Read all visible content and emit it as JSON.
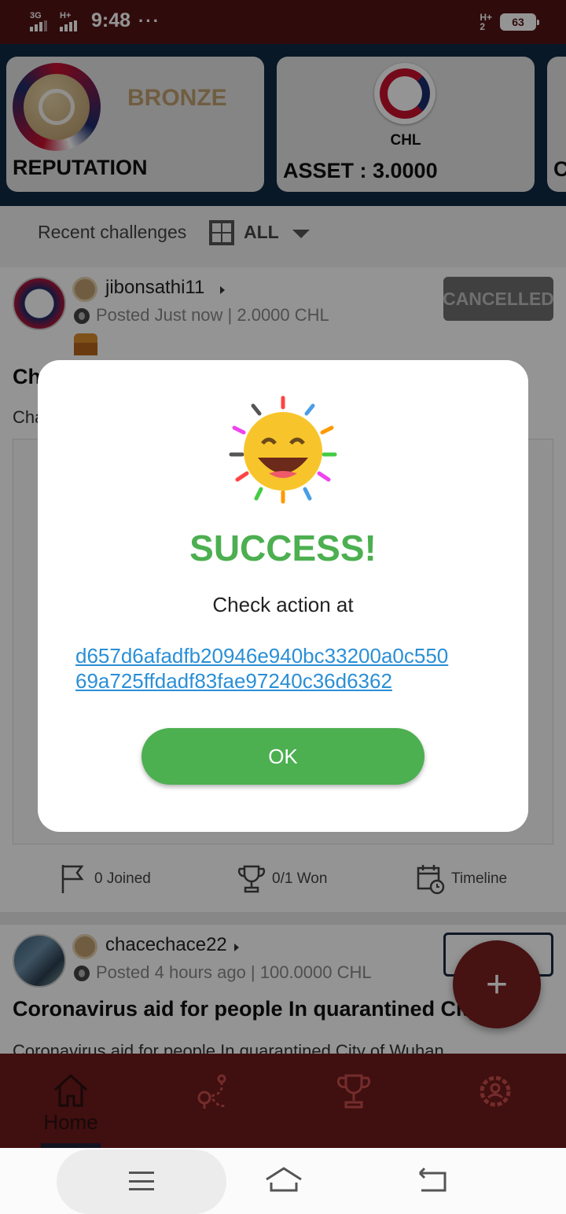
{
  "status_bar": {
    "time": "9:48",
    "dots": "···",
    "sim1_type": "3G",
    "sim2_type": "H+",
    "right_net_type": "H+",
    "right_net_sub": "2",
    "battery": "63"
  },
  "cards": {
    "reputation_level": "BRONZE",
    "reputation_label": "REPUTATION",
    "currency": "CHL",
    "asset_label": "ASSET : 3.0000",
    "third_card_stub": "C"
  },
  "filter": {
    "recent_label": "Recent challenges",
    "filter_value": "ALL"
  },
  "posts": [
    {
      "username": "jibonsathi11",
      "posted": "Posted Just now | 2.0000 CHL",
      "status": "CANCELLED",
      "title_visible": "Ch",
      "desc_visible": "Cha",
      "joined": "0 Joined",
      "won": "0/1 Won",
      "timeline": "Timeline"
    },
    {
      "username": "chacechace22",
      "posted": "Posted 4 hours ago | 100.0000 CHL",
      "title": "Coronavirus aid for people In quarantined City",
      "desc": "Coronavirus aid for people In quarantined City of Wuhan"
    }
  ],
  "fab_label": "+",
  "bottom_nav": {
    "home_label": "Home",
    "icons": [
      "home-icon",
      "map-route-icon",
      "trophy-icon",
      "settings-icon"
    ]
  },
  "modal": {
    "title": "SUCCESS!",
    "message": "Check action at",
    "hash_line1": "d657d6afadfb20946e940bc33200a0c550",
    "hash_line2": "69a725ffdadf83fae97240c36d6362",
    "ok_label": "OK"
  },
  "colors": {
    "status_bar": "#541315",
    "top_strip": "#0e2a44",
    "nav_bar": "#6e1a1a",
    "success_green": "#4caf50",
    "link_blue": "#2a8fd6",
    "bronze": "#c2a170"
  }
}
